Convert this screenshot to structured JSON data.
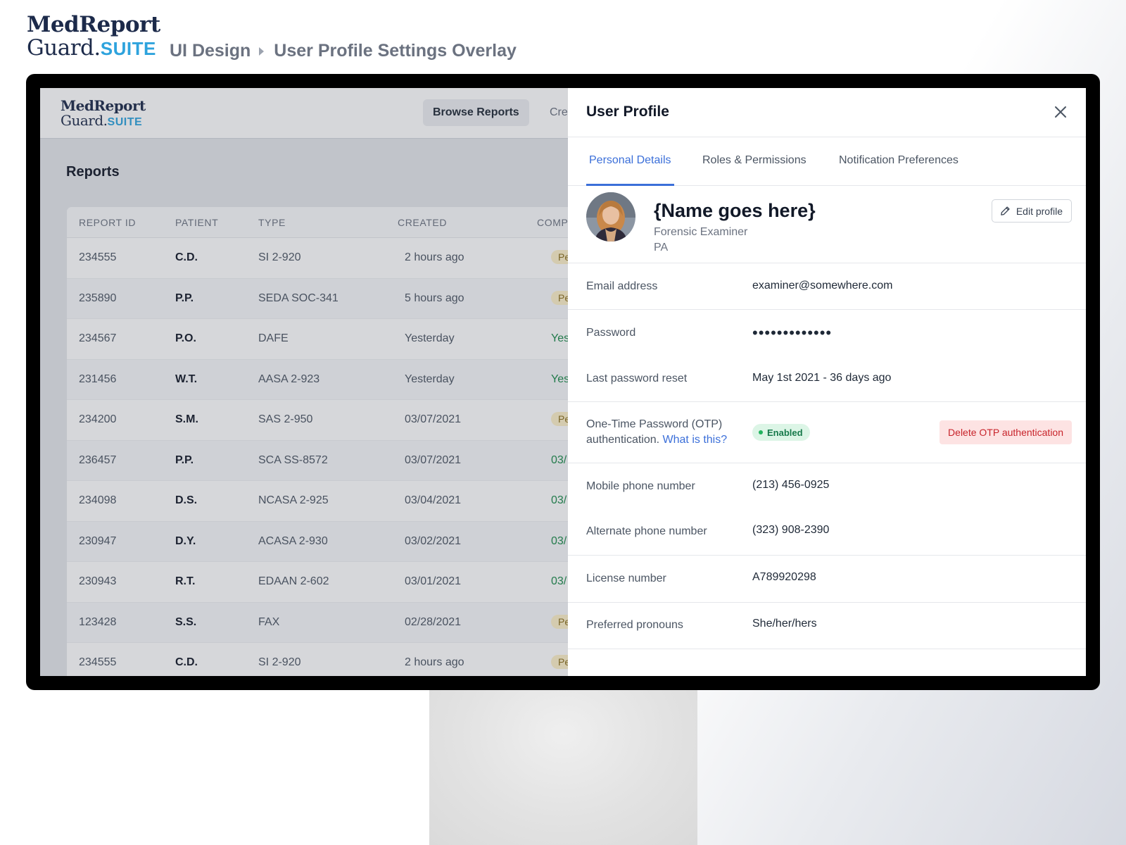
{
  "presentation": {
    "logo": {
      "line1": "MedReport",
      "line2": "Guard.",
      "suite": "SUITE"
    },
    "breadcrumb": [
      "UI Design",
      "User Profile Settings Overlay"
    ]
  },
  "app": {
    "logo": {
      "line1": "MedReport",
      "line2": "Guard.",
      "suite": "SUITE"
    },
    "nav": {
      "browse": "Browse Reports",
      "create": "Crea"
    },
    "page_title": "Reports",
    "table": {
      "headers": [
        "REPORT ID",
        "PATIENT",
        "TYPE",
        "CREATED",
        "COMPL"
      ],
      "rows": [
        {
          "id": "234555",
          "patient": "C.D.",
          "type": "SI 2-920",
          "created": "2 hours ago",
          "completed": "Pe",
          "status": "pending"
        },
        {
          "id": "235890",
          "patient": "P.P.",
          "type": "SEDA SOC-341",
          "created": "5 hours ago",
          "completed": "Pe",
          "status": "pending"
        },
        {
          "id": "234567",
          "patient": "P.O.",
          "type": "DAFE",
          "created": "Yesterday",
          "completed": "Yes",
          "status": "done"
        },
        {
          "id": "231456",
          "patient": "W.T.",
          "type": "AASA 2-923",
          "created": "Yesterday",
          "completed": "Yes",
          "status": "done"
        },
        {
          "id": "234200",
          "patient": "S.M.",
          "type": "SAS 2-950",
          "created": "03/07/2021",
          "completed": "Pe",
          "status": "pending"
        },
        {
          "id": "236457",
          "patient": "P.P.",
          "type": "SCA SS-8572",
          "created": "03/07/2021",
          "completed": "03/",
          "status": "done"
        },
        {
          "id": "234098",
          "patient": "D.S.",
          "type": "NCASA 2-925",
          "created": "03/04/2021",
          "completed": "03/",
          "status": "done"
        },
        {
          "id": "230947",
          "patient": "D.Y.",
          "type": "ACASA 2-930",
          "created": "03/02/2021",
          "completed": "03/",
          "status": "done"
        },
        {
          "id": "230943",
          "patient": "R.T.",
          "type": "EDAAN 2-602",
          "created": "03/01/2021",
          "completed": "03/",
          "status": "done"
        },
        {
          "id": "123428",
          "patient": "S.S.",
          "type": "FAX",
          "created": "02/28/2021",
          "completed": "Pe",
          "status": "pending"
        },
        {
          "id": "234555",
          "patient": "C.D.",
          "type": "SI 2-920",
          "created": "2 hours ago",
          "completed": "Pe",
          "status": "pending"
        }
      ]
    }
  },
  "panel": {
    "title": "User Profile",
    "tabs": [
      "Personal Details",
      "Roles & Permissions",
      "Notification Preferences"
    ],
    "active_tab": "Personal Details",
    "profile": {
      "name": "{Name goes here}",
      "role": "Forensic Examiner",
      "location": "PA",
      "edit_label": "Edit profile"
    },
    "fields": {
      "email": {
        "label": "Email address",
        "value": "examiner@somewhere.com"
      },
      "password": {
        "label": "Password",
        "value": "•••••••••••••"
      },
      "last_reset": {
        "label": "Last password reset",
        "value": "May 1st 2021 - 36 days ago"
      },
      "otp": {
        "label": "One-Time Password (OTP)",
        "label2": "authentication.",
        "link": "What is this?",
        "status": "Enabled",
        "delete_label": "Delete OTP authentication"
      },
      "mobile": {
        "label": "Mobile phone number",
        "value": "(213) 456-0925"
      },
      "alt_phone": {
        "label": "Alternate phone number",
        "value": "(323) 908-2390"
      },
      "license": {
        "label": "License number",
        "value": "A789920298"
      },
      "pronouns": {
        "label": "Preferred pronouns",
        "value": "She/her/hers"
      }
    }
  },
  "colors": {
    "accent": "#3b6fd9",
    "brand_navy": "#1c2a4a",
    "brand_suite": "#2ea3dd",
    "enabled_green": "#16794a",
    "danger_red": "#c8242b"
  },
  "icons": {
    "close": "close-icon",
    "edit": "pencil-icon",
    "status": "status-dot-icon"
  }
}
